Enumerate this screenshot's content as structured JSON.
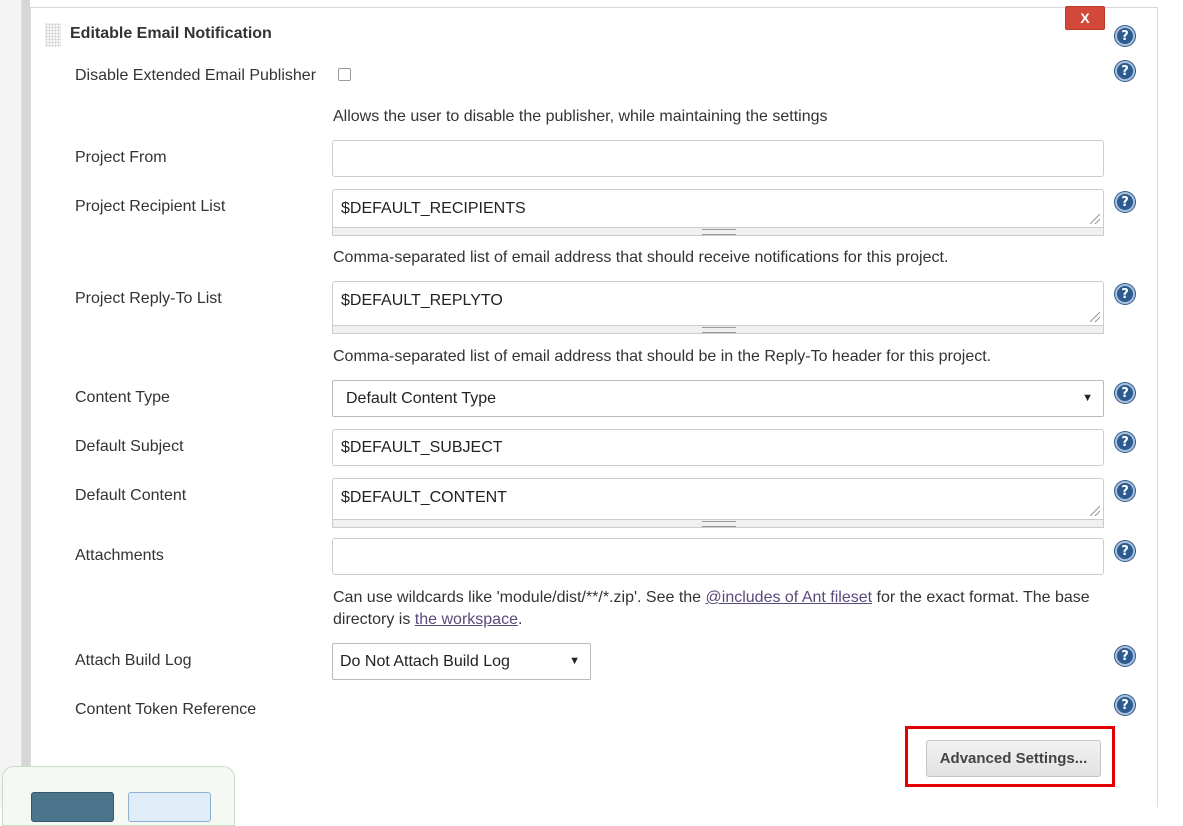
{
  "section": {
    "title": "Editable Email Notification",
    "close_label": "X"
  },
  "help_icon_glyph": "?",
  "fields": {
    "disable_publisher": {
      "label": "Disable Extended Email Publisher",
      "checked": false,
      "description": "Allows the user to disable the publisher, while maintaining the settings"
    },
    "project_from": {
      "label": "Project From",
      "value": ""
    },
    "recipient_list": {
      "label": "Project Recipient List",
      "value": "$DEFAULT_RECIPIENTS",
      "description": "Comma-separated list of email address that should receive notifications for this project."
    },
    "reply_to": {
      "label": "Project Reply-To List",
      "value": "$DEFAULT_REPLYTO",
      "description": "Comma-separated list of email address that should be in the Reply-To header for this project."
    },
    "content_type": {
      "label": "Content Type",
      "selected": "Default Content Type"
    },
    "default_subject": {
      "label": "Default Subject",
      "value": "$DEFAULT_SUBJECT"
    },
    "default_content": {
      "label": "Default Content",
      "value": "$DEFAULT_CONTENT"
    },
    "attachments": {
      "label": "Attachments",
      "value": "",
      "description_part1": "Can use wildcards like 'module/dist/**/*.zip'. See the ",
      "description_link1": "@includes of Ant fileset",
      "description_part2": " for the exact format. The base",
      "description_part3": "directory is ",
      "description_link2": "the workspace",
      "description_part4": "."
    },
    "attach_build_log": {
      "label": "Attach Build Log",
      "selected": "Do Not Attach Build Log"
    },
    "content_token_reference": {
      "label": "Content Token Reference"
    }
  },
  "buttons": {
    "advanced_settings": "Advanced Settings..."
  },
  "colors": {
    "close_button": "#d24939",
    "help_icon": "#2c5b8f",
    "highlight": "#e30000",
    "link": "#5a4a7b",
    "save_button": "#4b758b",
    "apply_button": "#e0ecf7"
  },
  "icons": {
    "dropdown_arrow": "▼"
  }
}
